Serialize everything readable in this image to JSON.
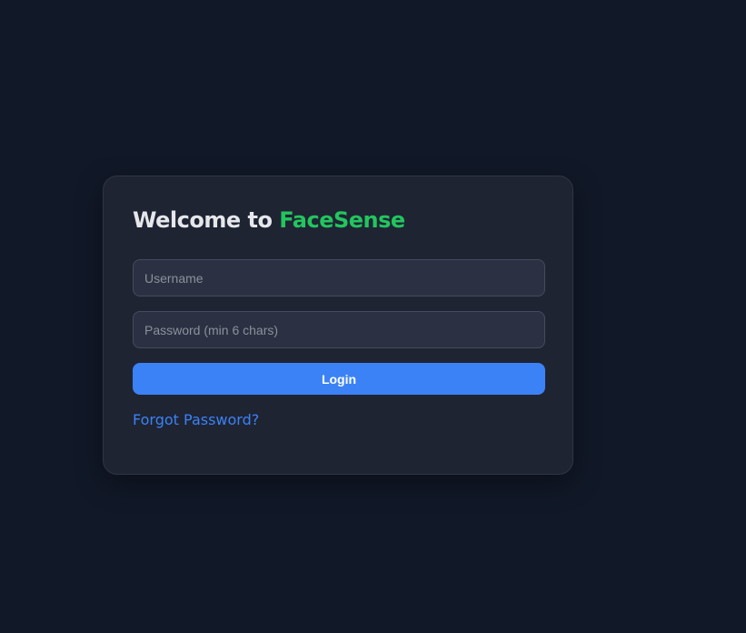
{
  "login": {
    "title_prefix": "Welcome to",
    "title_brand": "FaceSense",
    "username_placeholder": "Username",
    "username_value": "",
    "password_placeholder": "Password (min 6 chars)",
    "password_value": "",
    "login_label": "Login",
    "forgot_label": "Forgot Password?"
  },
  "colors": {
    "background": "#111827",
    "card": "#1f2433",
    "brand_accent": "#22c55e",
    "primary_button": "#3b82f6",
    "link": "#3b82f6"
  }
}
